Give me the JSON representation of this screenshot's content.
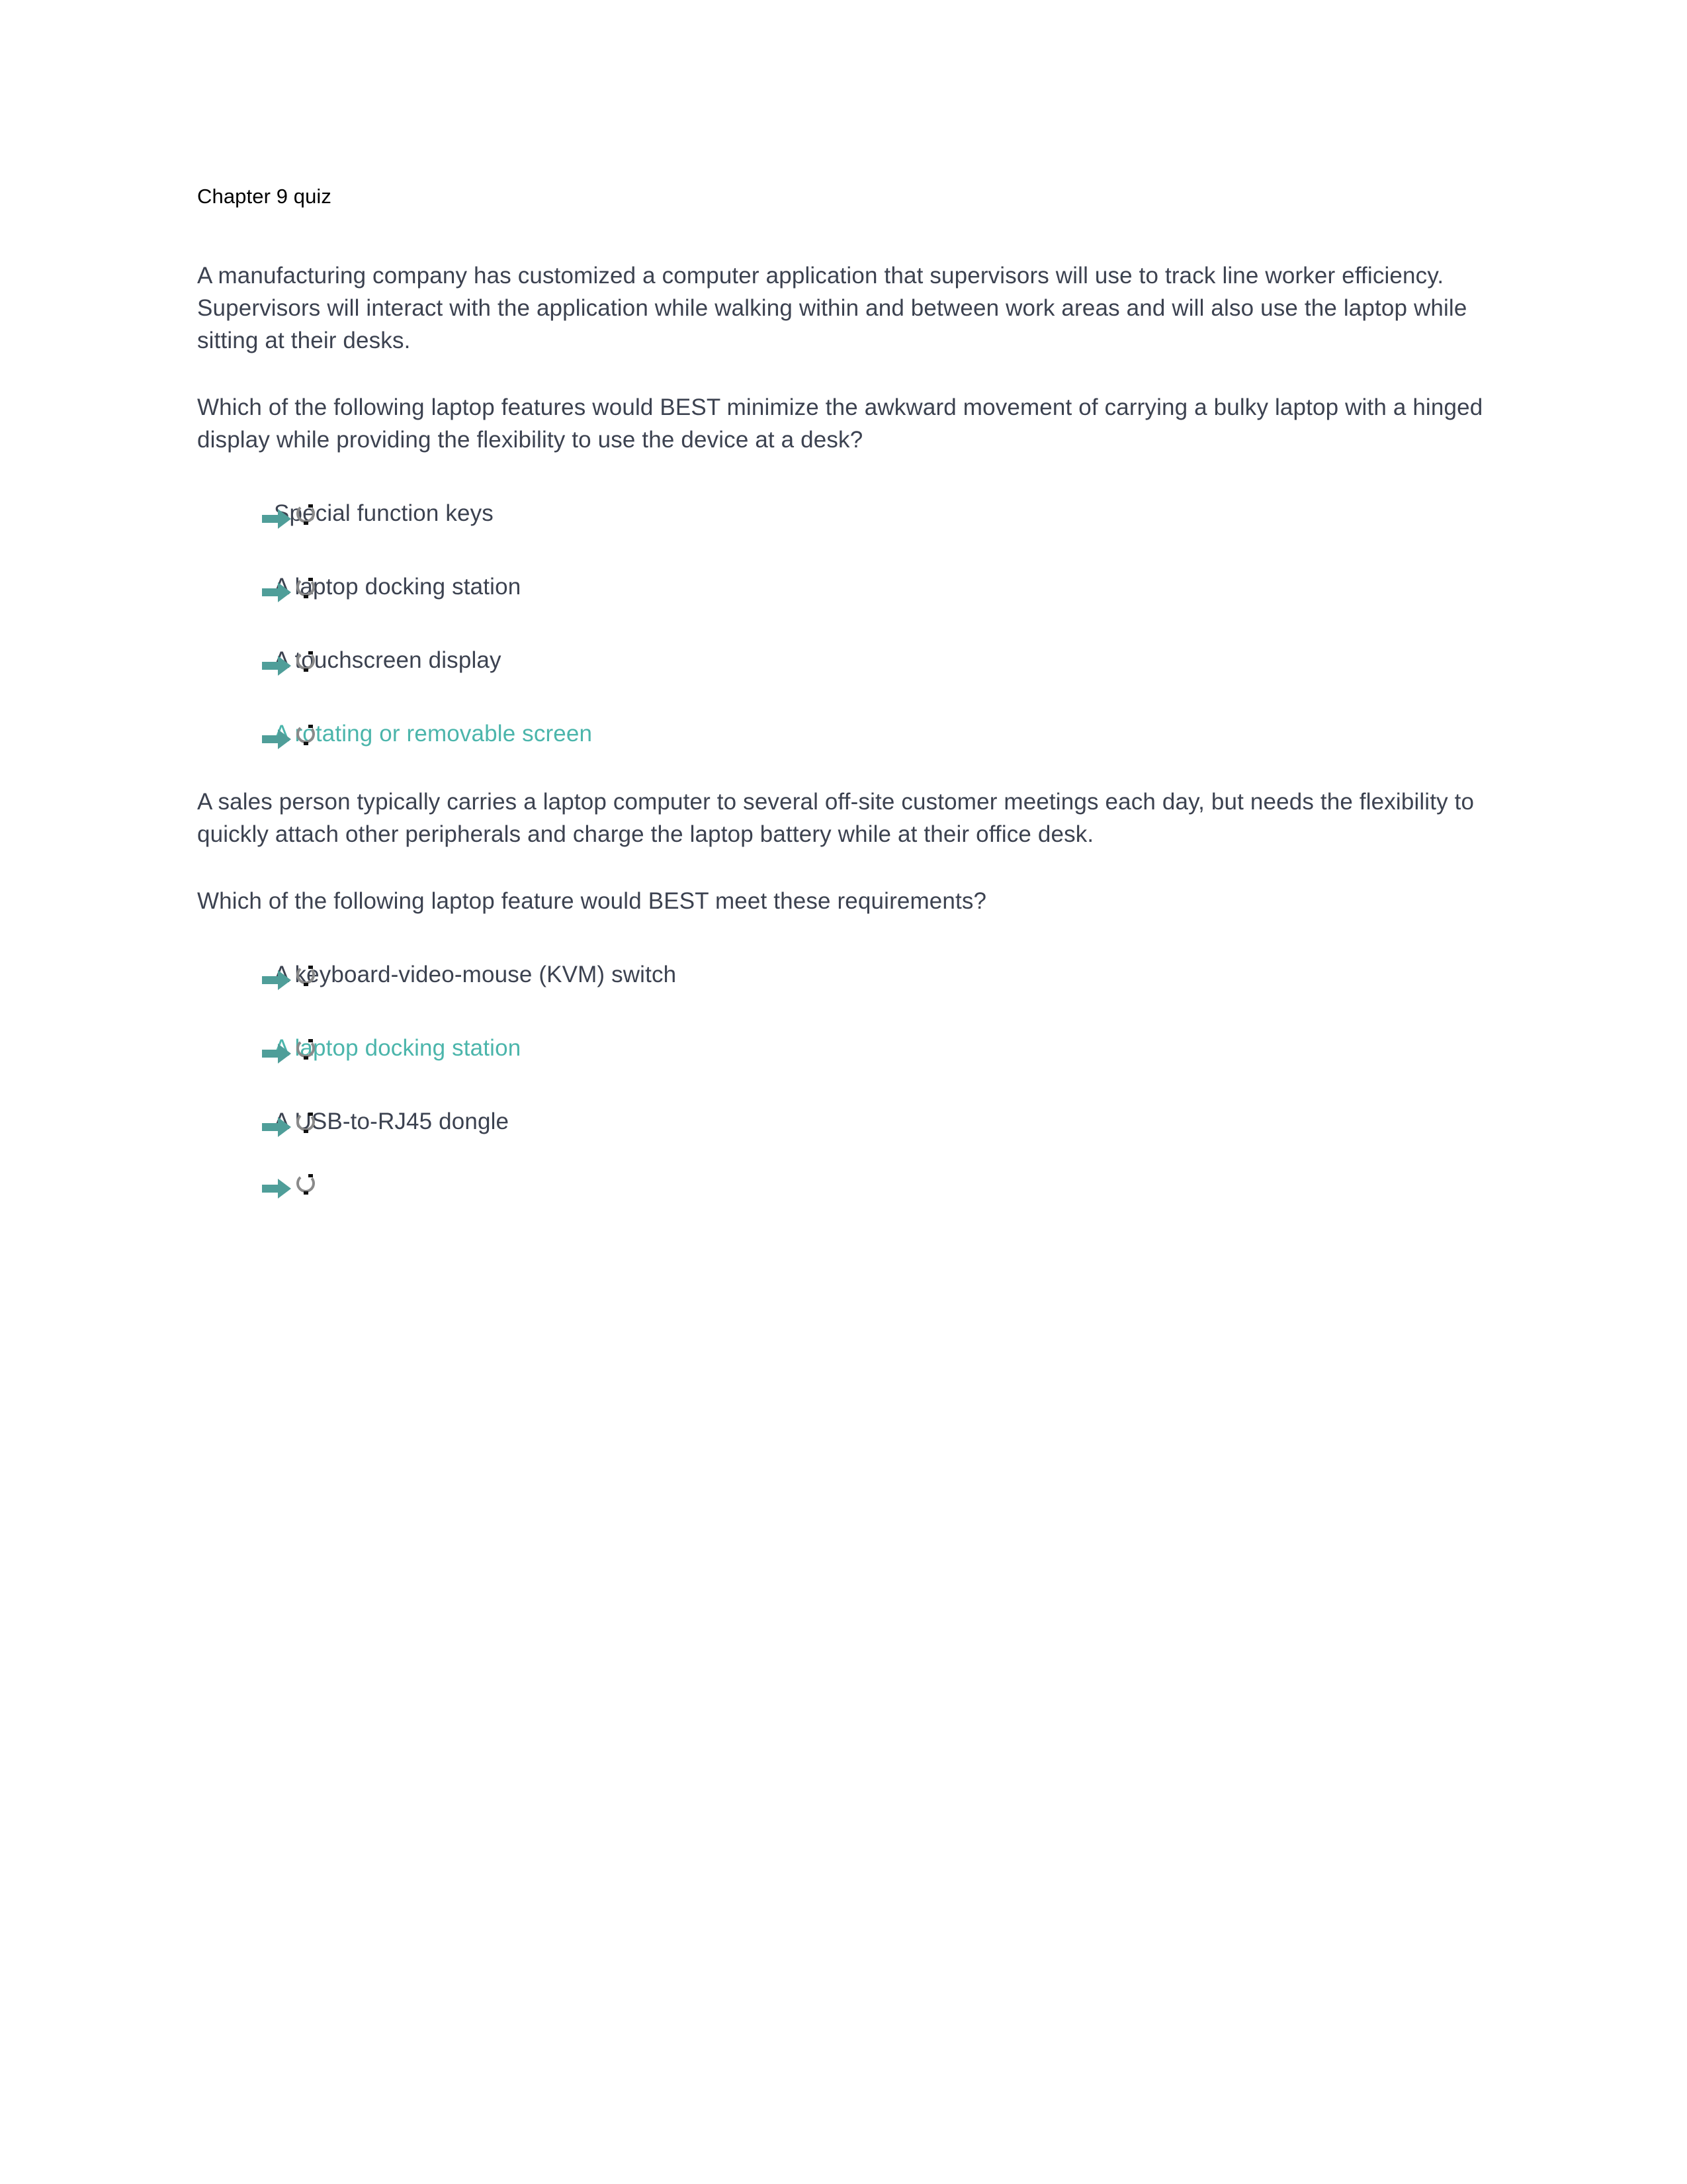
{
  "document": {
    "title": "Chapter 9 quiz"
  },
  "colors": {
    "body_text": "#3c4250",
    "title_text": "#000000",
    "highlight": "#4bb5ab",
    "arrow": "#4f9e99",
    "spinner": "#808080",
    "page_background": "#ffffff"
  },
  "icons": {
    "arrow": "arrow-right-icon",
    "spinner": "spinner-circle-icon"
  },
  "questions": [
    {
      "scenario": "A manufacturing company has customized a computer application that supervisors will use to track line worker efficiency. Supervisors will interact with the application while walking within and between work areas and will also use the laptop while sitting at their desks.",
      "prompt": "Which of the following laptop features would BEST minimize the awkward movement of carrying a bulky laptop with a hinged display while providing the flexibility to use the device at a desk?",
      "options": [
        {
          "label": "Special function keys",
          "highlighted": false
        },
        {
          "label": "A laptop docking station",
          "highlighted": false
        },
        {
          "label": "A touchscreen display",
          "highlighted": false
        },
        {
          "label": "A rotating or removable screen",
          "highlighted": true
        }
      ]
    },
    {
      "scenario": "A sales person typically carries a laptop computer to several off-site customer meetings each day, but needs the flexibility to quickly attach other peripherals and charge the laptop battery while at their office desk.",
      "prompt": "Which of the following laptop feature would BEST meet these requirements?",
      "options": [
        {
          "label": "A keyboard-video-mouse (KVM) switch",
          "highlighted": false
        },
        {
          "label": "A laptop docking station",
          "highlighted": true
        },
        {
          "label": "A USB-to-RJ45 dongle",
          "highlighted": false
        },
        {
          "label": "",
          "highlighted": false
        }
      ]
    }
  ]
}
